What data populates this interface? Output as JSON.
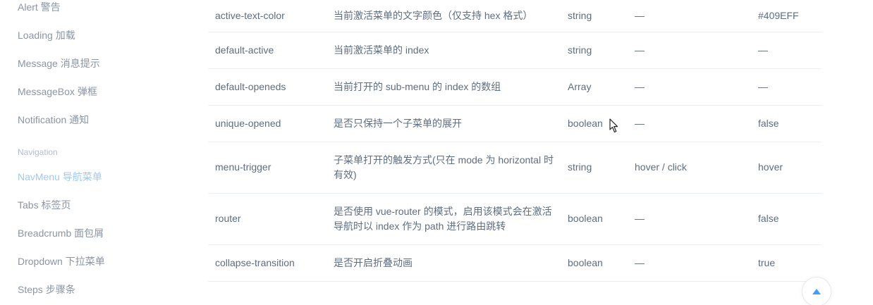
{
  "sidebar": {
    "items_top": [
      {
        "label": "Alert 警告"
      },
      {
        "label": "Loading 加载"
      },
      {
        "label": "Message 消息提示"
      },
      {
        "label": "MessageBox 弹框"
      },
      {
        "label": "Notification 通知"
      }
    ],
    "group_label": "Navigation",
    "items_bottom": [
      {
        "label": "NavMenu 导航菜单",
        "active": true
      },
      {
        "label": "Tabs 标签页"
      },
      {
        "label": "Breadcrumb 面包屑"
      },
      {
        "label": "Dropdown 下拉菜单"
      },
      {
        "label": "Steps 步骤条"
      }
    ],
    "active_color": "#9fc9f5"
  },
  "table": {
    "rows": [
      {
        "param": "active-text-color",
        "desc": "当前激活菜单的文字颜色（仅支持 hex 格式）",
        "type": "string",
        "options": "—",
        "default": "#409EFF"
      },
      {
        "param": "default-active",
        "desc": "当前激活菜单的 index",
        "type": "string",
        "options": "—",
        "default": "—"
      },
      {
        "param": "default-openeds",
        "desc": "当前打开的 sub-menu 的 index 的数组",
        "type": "Array",
        "options": "—",
        "default": "—"
      },
      {
        "param": "unique-opened",
        "desc": "是否只保持一个子菜单的展开",
        "type": "boolean",
        "options": "—",
        "default": "false"
      },
      {
        "param": "menu-trigger",
        "desc": "子菜单打开的触发方式(只在 mode 为 horizontal 时有效)",
        "type": "string",
        "options": "hover / click",
        "default": "hover"
      },
      {
        "param": "router",
        "desc": "是否使用 vue-router 的模式，启用该模式会在激活导航时以 index 作为 path 进行路由跳转",
        "type": "boolean",
        "options": "—",
        "default": "false"
      },
      {
        "param": "collapse-transition",
        "desc": "是否开启折叠动画",
        "type": "boolean",
        "options": "—",
        "default": "true"
      }
    ]
  },
  "icons": {
    "back_to_top": "caret-up-icon",
    "cursor": "mouse-pointer-icon"
  },
  "colors": {
    "accent": "#409EFF",
    "text": "#5e6d82",
    "border": "#eaeefb"
  }
}
